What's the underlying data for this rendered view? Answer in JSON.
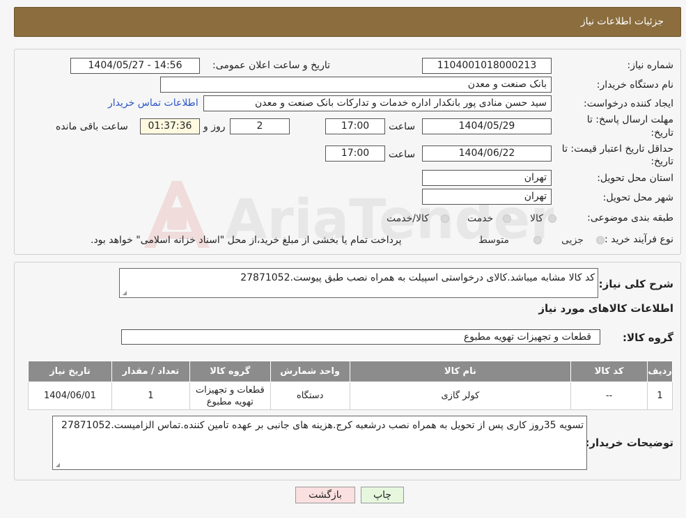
{
  "header": {
    "title": "جزئیات اطلاعات نیاز"
  },
  "watermark": {
    "text": "AriaTender.neT"
  },
  "form": {
    "need_number_label": "شماره نیاز:",
    "need_number": "1104001018000213",
    "announce_label": "تاریخ و ساعت اعلان عمومی:",
    "announce_value": "1404/05/27 - 14:56",
    "buyer_org_label": "نام دستگاه خریدار:",
    "buyer_org": "بانک صنعت و معدن",
    "creator_label": "ایجاد کننده درخواست:",
    "creator": "سید حسن منادی پور بانکدار اداره خدمات و تدارکات بانک صنعت و معدن",
    "contact_link": "اطلاعات تماس خریدار",
    "deadline_label_1": "مهلت ارسال پاسخ: تا",
    "deadline_label_2": "تاریخ:",
    "deadline_date": "1404/05/29",
    "time_label": "ساعت",
    "deadline_time": "17:00",
    "days_value": "2",
    "days_label": "روز و",
    "remaining_time": "01:37:36",
    "remaining_label": "ساعت باقی مانده",
    "validity_label_1": "حداقل تاریخ اعتبار قیمت: تا",
    "validity_label_2": "تاریخ:",
    "validity_date": "1404/06/22",
    "validity_time": "17:00",
    "province_label": "استان محل تحویل:",
    "province": "تهران",
    "city_label": "شهر محل تحویل:",
    "city": "تهران",
    "category_label": "طبقه بندی موضوعی:",
    "category_options": [
      "کالا",
      "خدمت",
      "کالا/خدمت"
    ],
    "purchase_type_label": "نوع فرآیند خرید :",
    "purchase_options": [
      "جزیی",
      "متوسط"
    ],
    "purchase_note": "پرداخت تمام یا بخشی از مبلغ خرید،از محل \"اسناد خزانه اسلامی\" خواهد بود."
  },
  "summary": {
    "label": "شرح کلی نیاز:",
    "text": "کد کالا مشابه میباشد.کالای درخواستی اسپیلت به همراه نصب طبق پیوست.27871052"
  },
  "items_section": {
    "title": "اطلاعات کالاهای مورد نیاز",
    "group_label": "گروه کالا:",
    "group_value": "قطعات و تجهیزات تهویه مطبوع"
  },
  "table": {
    "headers": [
      "ردیف",
      "کد کالا",
      "نام کالا",
      "واحد شمارش",
      "گروه کالا",
      "تعداد / مقدار",
      "تاریخ نیاز"
    ],
    "rows": [
      [
        "1",
        "--",
        "کولر گازی",
        "دستگاه",
        "قطعات و تجهیزات تهویه مطبوع",
        "1",
        "1404/06/01"
      ]
    ]
  },
  "buyer_notes": {
    "label": "توضیحات خریدار:",
    "text": "تسویه 35روز کاری پس از تحویل به همراه نصب درشعبه کرج.هزینه های جانبی بر عهده تامین کننده.تماس الزامیست.27871052"
  },
  "buttons": {
    "print": "چاپ",
    "back": "بازگشت"
  }
}
